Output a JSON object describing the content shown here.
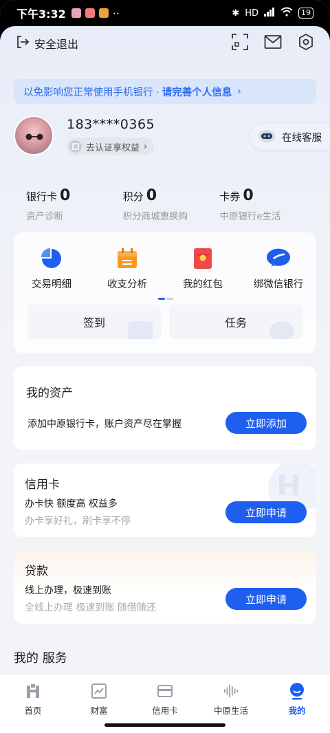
{
  "status_bar": {
    "time": "下午3:32",
    "dots": "··",
    "network": "HD",
    "battery": "19",
    "app_icons": [
      "#e9a3c0",
      "#f27a7a",
      "#e8a23c"
    ]
  },
  "header": {
    "logout_label": "安全退出",
    "icons": [
      "scan-icon",
      "mail-icon",
      "settings-icon"
    ]
  },
  "banner": {
    "prefix": "以免影响您正常使用手机银行 · ",
    "action": "请完善个人信息",
    "chevron": "›"
  },
  "profile": {
    "phone": "183****0365",
    "verify_label": "去认证享权益",
    "verify_chevron": "›",
    "service_label": "在线客服"
  },
  "stats": [
    {
      "label": "银行卡",
      "value": "0",
      "sub": "资产诊断"
    },
    {
      "label": "积分",
      "value": "0",
      "sub": "积分商城惠换购"
    },
    {
      "label": "卡券",
      "value": "0",
      "sub": "中原银行e生活"
    }
  ],
  "quick": {
    "items": [
      {
        "label": "交易明细",
        "icon": "pie-chart-icon"
      },
      {
        "label": "收支分析",
        "icon": "calendar-icon"
      },
      {
        "label": "我的红包",
        "icon": "red-envelope-icon"
      },
      {
        "label": "绑微信银行",
        "icon": "wechat-icon"
      }
    ],
    "buttons": [
      "签到",
      "任务"
    ]
  },
  "assets_card": {
    "title": "我的资产",
    "text": "添加中原银行卡，账户资产尽在掌握",
    "button": "立即添加"
  },
  "credit_card": {
    "title": "信用卡",
    "line1": "办卡快 额度高 权益多",
    "line2": "办卡享好礼，刷卡享不停",
    "button": "立即申请"
  },
  "loan_card": {
    "title": "贷款",
    "line1": "线上办理，极速到账",
    "line2": "全线上办理 极速到账 随借随还",
    "button": "立即申请"
  },
  "services": {
    "title": "我的 服务"
  },
  "nav": [
    {
      "label": "首页",
      "icon": "home-icon",
      "active": false
    },
    {
      "label": "财富",
      "icon": "wealth-icon",
      "active": false
    },
    {
      "label": "信用卡",
      "icon": "credit-card-icon",
      "active": false
    },
    {
      "label": "中原生活",
      "icon": "life-icon",
      "active": false
    },
    {
      "label": "我的",
      "icon": "profile-icon",
      "active": true
    }
  ],
  "colors": {
    "accent": "#1f5fef",
    "banner_bg": "#d9e5fb"
  }
}
